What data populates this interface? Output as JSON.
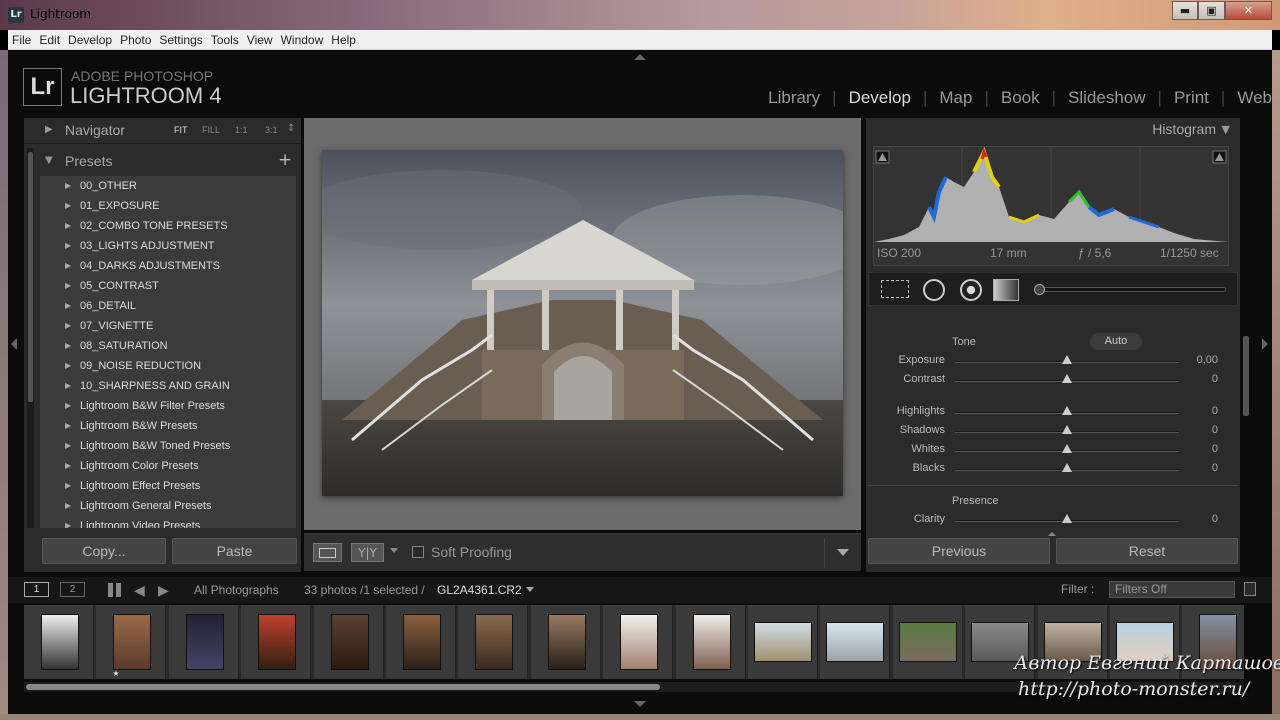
{
  "window": {
    "title": "Lightroom",
    "icon_text": "Lr",
    "min": "▬",
    "max": "▣",
    "close": "✕"
  },
  "menubar": [
    "File",
    "Edit",
    "Develop",
    "Photo",
    "Settings",
    "Tools",
    "View",
    "Window",
    "Help"
  ],
  "brand": {
    "badge": "Lr",
    "line1": "ADOBE PHOTOSHOP",
    "line2": "LIGHTROOM 4"
  },
  "modules": [
    {
      "label": "Library"
    },
    {
      "label": "Develop",
      "active": true
    },
    {
      "label": "Map"
    },
    {
      "label": "Book"
    },
    {
      "label": "Slideshow"
    },
    {
      "label": "Print"
    },
    {
      "label": "Web"
    }
  ],
  "navigator": {
    "title": "Navigator",
    "zoom": [
      "FIT",
      "FILL",
      "1:1",
      "3:1"
    ],
    "zoom_arrow": "⇕"
  },
  "presets": {
    "title": "Presets",
    "add": "+",
    "items": [
      "00_OTHER",
      "01_EXPOSURE",
      "02_COMBO TONE PRESETS",
      "03_LIGHTS ADJUSTMENT",
      "04_DARKS ADJUSTMENTS",
      "05_CONTRAST",
      "06_DETAIL",
      "07_VIGNETTE",
      "08_SATURATION",
      "09_NOISE REDUCTION",
      "10_SHARPNESS AND GRAIN",
      "Lightroom B&W Filter Presets",
      "Lightroom B&W Presets",
      "Lightroom B&W Toned Presets",
      "Lightroom Color Presets",
      "Lightroom Effect Presets",
      "Lightroom General Presets",
      "Lightroom Video Presets"
    ]
  },
  "left_buttons": {
    "copy": "Copy...",
    "paste": "Paste"
  },
  "toolbar": {
    "yy": "Y|Y",
    "soft_proofing": "Soft Proofing"
  },
  "histogram": {
    "title": "Histogram",
    "iso": "ISO 200",
    "focal": "17 mm",
    "aperture": "ƒ / 5,6",
    "shutter": "1/1250 sec"
  },
  "basic": {
    "tone_label": "Tone",
    "auto": "Auto",
    "tone": [
      {
        "label": "Exposure",
        "value": "0,00",
        "pos": 0.5
      },
      {
        "label": "Contrast",
        "value": "0",
        "pos": 0.5
      }
    ],
    "tone2": [
      {
        "label": "Highlights",
        "value": "0",
        "pos": 0.5
      },
      {
        "label": "Shadows",
        "value": "0",
        "pos": 0.5
      },
      {
        "label": "Whites",
        "value": "0",
        "pos": 0.5
      },
      {
        "label": "Blacks",
        "value": "0",
        "pos": 0.5
      }
    ],
    "presence_label": "Presence",
    "presence": [
      {
        "label": "Clarity",
        "value": "0",
        "pos": 0.5
      }
    ]
  },
  "right_buttons": {
    "previous": "Previous",
    "reset": "Reset"
  },
  "filmbar": {
    "screen1": "1",
    "screen2": "2",
    "source": "All Photographs",
    "count": "33 photos /1 selected /",
    "filename": "GL2A4361.CR2",
    "filter_label": "Filter :",
    "filter_value": "Filters Off"
  },
  "filmstrip": {
    "star": "★"
  },
  "watermark": {
    "line1": "Автор Евгений Карташов",
    "line2": "http://photo-monster.ru/"
  }
}
